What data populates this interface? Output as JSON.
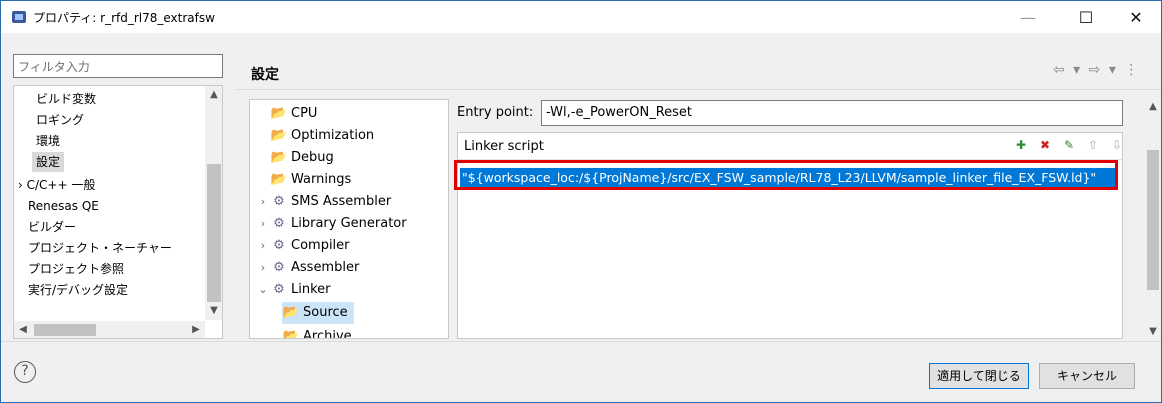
{
  "window": {
    "title": "プロパティ: r_rfd_rl78_extrafsw",
    "controls": {
      "minimize": "—",
      "maximize": "☐",
      "close": "✕"
    }
  },
  "filter": {
    "placeholder": "フィルタ入力"
  },
  "nav": {
    "items": [
      "ビルド変数",
      "ロギング",
      "環境",
      "設定",
      "C/C++ 一般",
      "Renesas QE",
      "ビルダー",
      "プロジェクト・ネーチャー",
      "プロジェクト参照",
      "実行/デバッグ設定"
    ],
    "selected": "設定"
  },
  "header": {
    "title": "設定",
    "nav_arrows": "⇦ ▾ ⇨ ▾ ⋮"
  },
  "settings_tree": {
    "items": [
      {
        "label": "CPU",
        "icon": "folder-icon"
      },
      {
        "label": "Optimization",
        "icon": "folder-icon"
      },
      {
        "label": "Debug",
        "icon": "folder-icon"
      },
      {
        "label": "Warnings",
        "icon": "folder-icon"
      },
      {
        "label": "SMS Assembler",
        "icon": "gear-icon",
        "expander": "›"
      },
      {
        "label": "Library Generator",
        "icon": "gear-icon",
        "expander": "›"
      },
      {
        "label": "Compiler",
        "icon": "gear-icon",
        "expander": "›"
      },
      {
        "label": "Assembler",
        "icon": "gear-icon",
        "expander": "›"
      },
      {
        "label": "Linker",
        "icon": "gear-icon",
        "expander": "⌄"
      },
      {
        "label": "Source",
        "icon": "folder-icon",
        "selected": true
      },
      {
        "label": "Archive",
        "icon": "folder-icon"
      }
    ]
  },
  "entry_point": {
    "label": "Entry point:",
    "value": "-Wl,-e_PowerON_Reset"
  },
  "linker_script": {
    "title": "Linker script",
    "items": [
      "\"${workspace_loc:/${ProjName}/src/EX_FSW_sample/RL78_L23/LLVM/sample_linker_file_EX_FSW.ld}\""
    ]
  },
  "footer": {
    "help": "?",
    "apply_close": "適用して閉じる",
    "cancel": "キャンセル"
  },
  "colors": {
    "selection": "#0078d7",
    "highlight_border": "#e00000"
  }
}
